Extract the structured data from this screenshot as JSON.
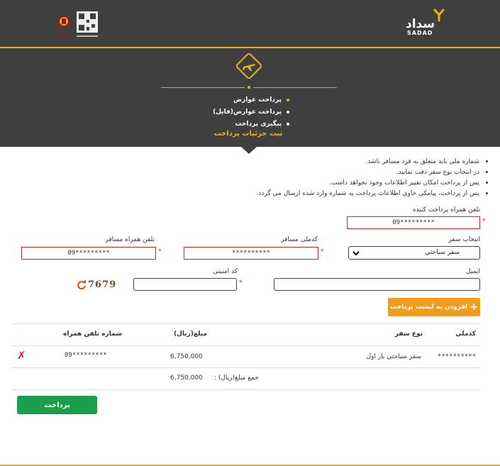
{
  "brand": {
    "name_fa": "سداد",
    "name_en": "SADAD",
    "bank_caption": "بانک ملی ایران",
    "gold": "#e6b21e",
    "header_bg": "#3f3f3f"
  },
  "menu": [
    {
      "label": "پرداخت عوارض",
      "active": true
    },
    {
      "label": "پرداخت عوارض(فایل)",
      "active": false
    },
    {
      "label": "پیگیری پرداخت",
      "active": false
    }
  ],
  "section_title": "ثبت جزئیات پرداخت",
  "notes": [
    "شماره ملی باید متعلق به فرد مسافر باشد.",
    "در انتخاب نوع سفر دقت نمایید.",
    "پس از پرداخت امکان تغییر اطلاعات وجود نخواهد داشت.",
    "پس از پرداخت، پیامکی حاوی اطلاعات پرداخت به شماره وارد شده ارسال می گردد."
  ],
  "form": {
    "payer_phone_label": "تلفن همراه پرداخت کننده",
    "payer_phone_value": "09*********",
    "trip_label": "انتخاب سفر",
    "trip_value": "سفر سیاحتي",
    "national_code_label": "کدملی مسافر",
    "national_code_value": "**********",
    "passenger_phone_label": "تلفن همراه مسافر",
    "passenger_phone_value": "09*********",
    "email_label": "ایمیل",
    "email_value": "",
    "captcha_label": "کد امنیتی",
    "captcha_value": "",
    "captcha_image_text": "7679",
    "add_button": "افزودن به لیست پرداخت"
  },
  "table": {
    "headers": {
      "code": "کدملی",
      "trip_type": "نوع سفر",
      "amount": "مبلغ(ریال)",
      "phone": "شماره تلفن همراه"
    },
    "rows": [
      {
        "code": "**********",
        "trip_type": "سفر سیاحتي  بار اول",
        "amount": "6,750,000",
        "phone": "09*********"
      }
    ],
    "total_label": "جمع مبلغ(ریال) :",
    "total_value": "6,750,000"
  },
  "pay_button": "پرداخت"
}
